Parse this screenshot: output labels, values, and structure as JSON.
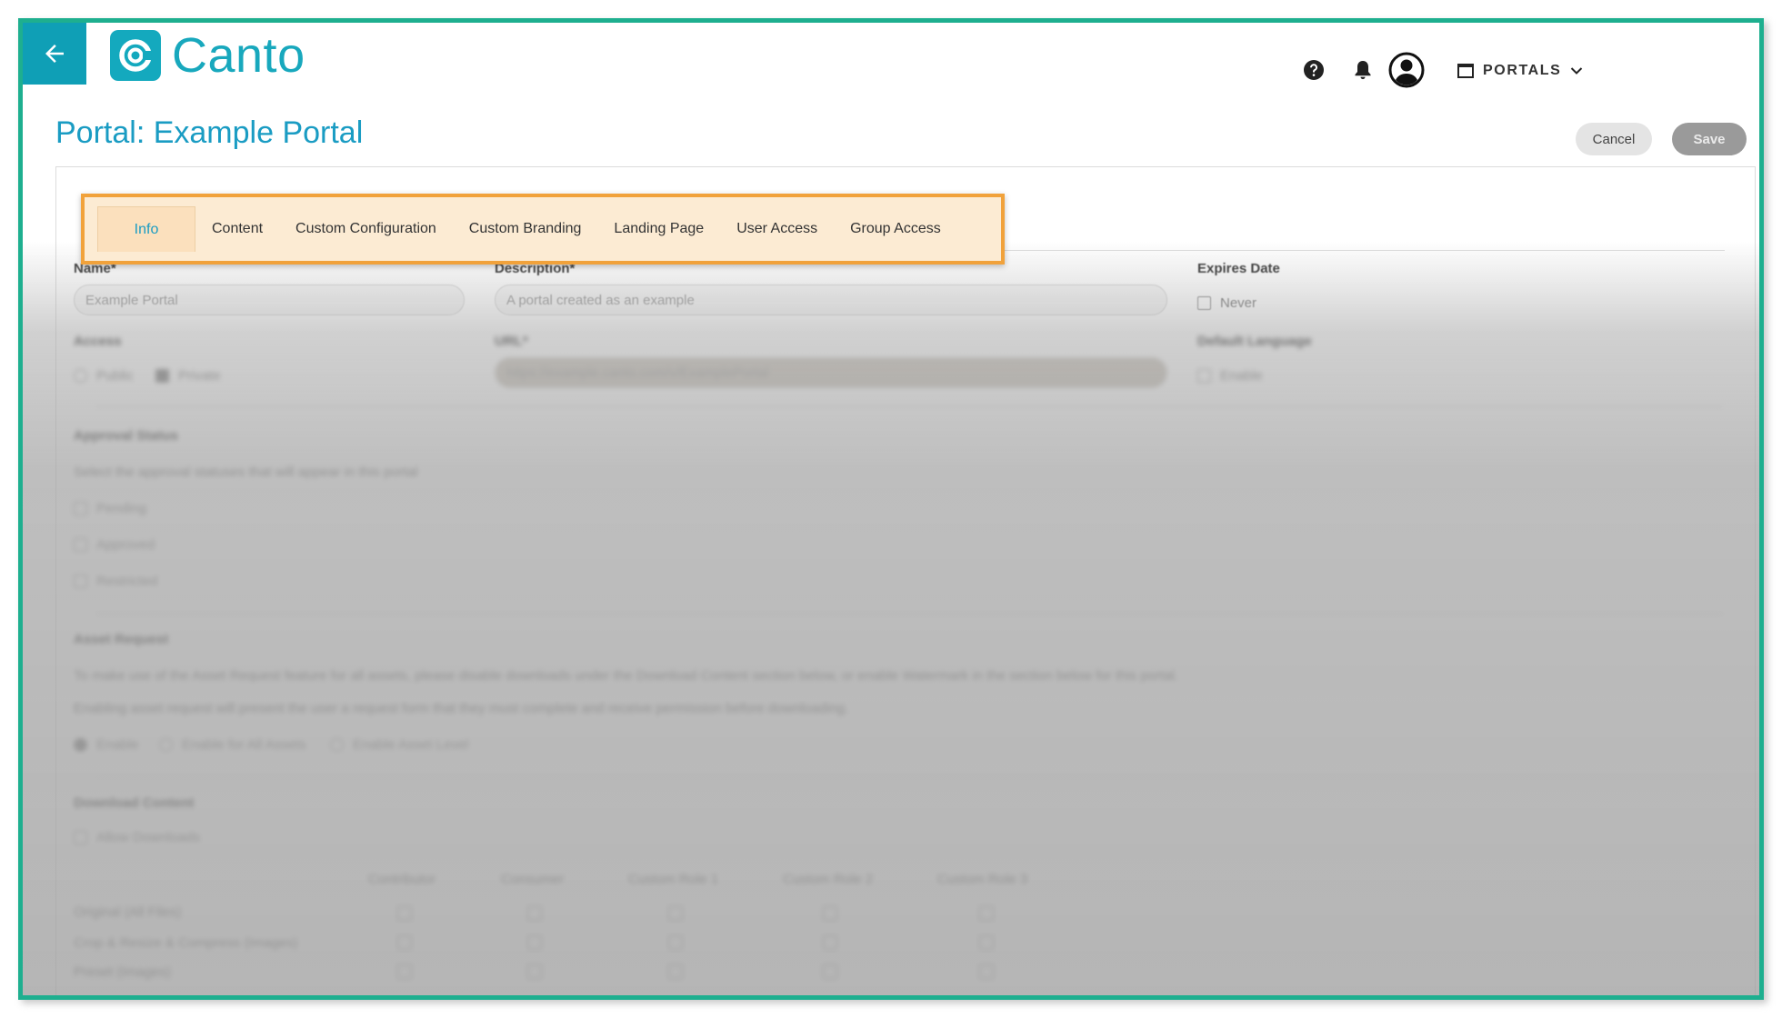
{
  "header": {
    "logo_text": "Canto",
    "portals_label": "PORTALS"
  },
  "page": {
    "title": "Portal: Example Portal",
    "cancel_label": "Cancel",
    "save_label": "Save"
  },
  "tabs": [
    {
      "label": "Info",
      "active": true
    },
    {
      "label": "Content",
      "active": false
    },
    {
      "label": "Custom Configuration",
      "active": false
    },
    {
      "label": "Custom Branding",
      "active": false
    },
    {
      "label": "Landing Page",
      "active": false
    },
    {
      "label": "User Access",
      "active": false
    },
    {
      "label": "Group Access",
      "active": false
    }
  ],
  "form": {
    "name_label": "Name*",
    "name_value": "Example Portal",
    "description_label": "Description*",
    "description_value": "A portal created as an example",
    "expires_label": "Expires Date",
    "expires_option": "Never",
    "access_label": "Access",
    "access_public": "Public",
    "access_private": "Private",
    "url_label": "URL*",
    "url_value": "https://example.canto.com/v/ExamplePortal",
    "default_language_label": "Default Language",
    "default_language_option": "Enable",
    "approval_label": "Approval Status",
    "approval_help": "Select the approval statuses that will appear in this portal",
    "approval_options": [
      "Pending",
      "Approved",
      "Restricted"
    ],
    "asset_request_label": "Asset Request",
    "asset_request_help1": "To make use of the Asset Request feature for all assets, please disable downloads under the Download Content section below, or enable Watermark in the section below for this portal.",
    "asset_request_help2": "Enabling asset request will present the user a request form that they must complete and receive permission before downloading.",
    "asset_request_options": [
      "Enable",
      "Enable for All Assets",
      "Enable Asset Level"
    ],
    "download_label": "Download Content",
    "allow_downloads": "Allow Downloads",
    "download_columns": [
      "Contributor",
      "Consumer",
      "Custom Role 1",
      "Custom Role 2",
      "Custom Role 3"
    ],
    "download_rows": [
      "Original (All Files)",
      "Crop & Resize & Compress (Images)",
      "Preset (Images)"
    ]
  }
}
